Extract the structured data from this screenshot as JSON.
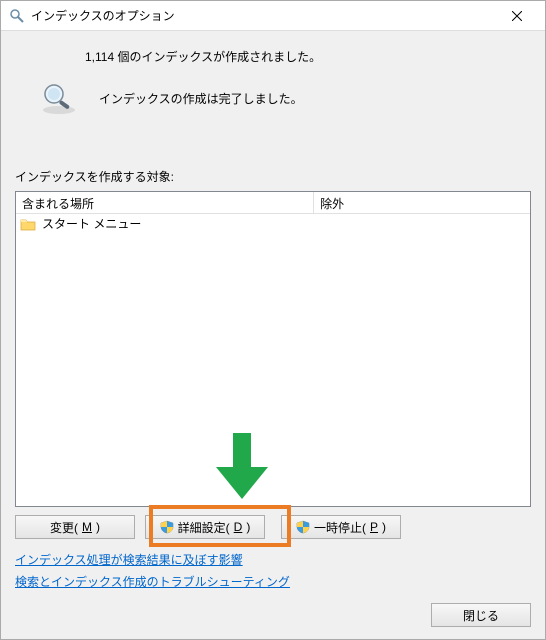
{
  "window": {
    "title": "インデックスのオプション"
  },
  "status": {
    "countLine": "1,114 個のインデックスが作成されました。",
    "completionLine": "インデックスの作成は完了しました。"
  },
  "section": {
    "targetLabel": "インデックスを作成する対象:"
  },
  "listHeader": {
    "col1": "含まれる場所",
    "col2": "除外"
  },
  "listItems": [
    {
      "icon": "folder",
      "label": "スタート メニュー"
    }
  ],
  "buttons": {
    "changePrefix": "変更(",
    "changeMnemonic": "M",
    "changeSuffix": ")",
    "advancedPrefix": "詳細設定(",
    "advancedMnemonic": "D",
    "advancedSuffix": ")",
    "pausePrefix": "一時停止(",
    "pauseMnemonic": "P",
    "pauseSuffix": ")"
  },
  "links": {
    "link1": "インデックス処理が検索結果に及ぼす影響",
    "link2": "検索とインデックス作成のトラブルシューティング"
  },
  "footer": {
    "close": "閉じる"
  }
}
